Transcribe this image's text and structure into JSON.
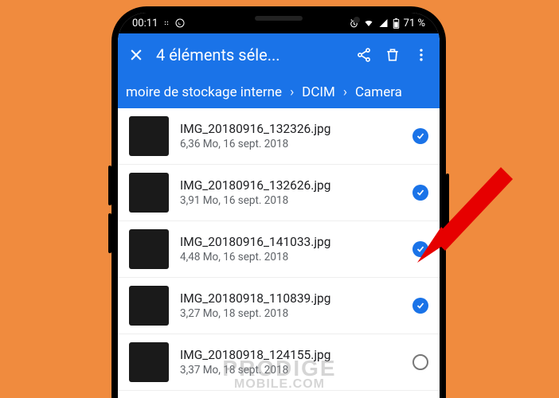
{
  "colors": {
    "accent": "#1a73e8",
    "bg": "#f08b3e"
  },
  "status": {
    "time": "00:11",
    "battery": "71 %"
  },
  "header": {
    "title": "4 éléments séle..."
  },
  "breadcrumbs": [
    "moire de stockage interne",
    "DCIM",
    "Camera"
  ],
  "files": [
    {
      "name": "IMG_20180916_132326.jpg",
      "meta": "6,36 Mo, 16 sept. 2018",
      "selected": true
    },
    {
      "name": "IMG_20180916_132626.jpg",
      "meta": "3,91 Mo, 16 sept. 2018",
      "selected": true
    },
    {
      "name": "IMG_20180916_141033.jpg",
      "meta": "4,48 Mo, 16 sept. 2018",
      "selected": true
    },
    {
      "name": "IMG_20180918_110839.jpg",
      "meta": "3,27 Mo, 18 sept. 2018",
      "selected": true
    },
    {
      "name": "IMG_20180918_124155.jpg",
      "meta": "3,37 Mo, 18 sept. 2018",
      "selected": false
    }
  ],
  "watermark": {
    "line1": "PRODIGE",
    "line2": "MOBILE.COM"
  }
}
